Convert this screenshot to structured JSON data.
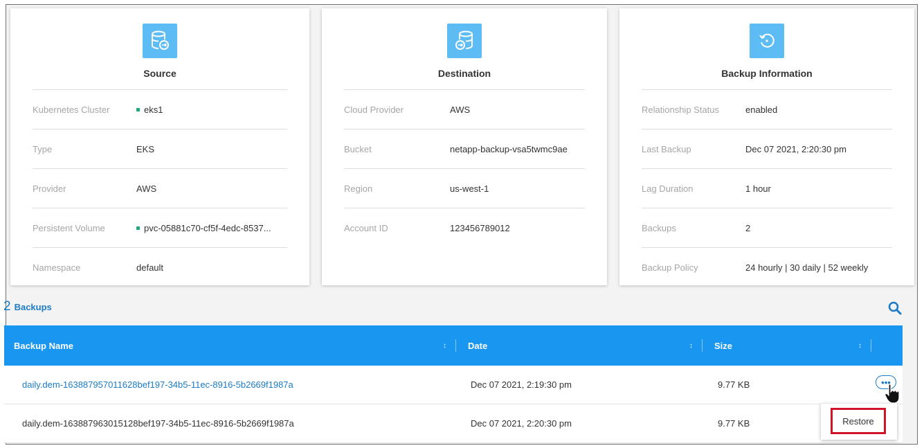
{
  "source": {
    "title": "Source",
    "icon": "database-arrow-icon",
    "rows": [
      {
        "label": "Kubernetes Cluster",
        "value": "eks1",
        "status": "active"
      },
      {
        "label": "Type",
        "value": "EKS"
      },
      {
        "label": "Provider",
        "value": "AWS"
      },
      {
        "label": "Persistent Volume",
        "value": "pvc-05881c70-cf5f-4edc-8537...",
        "status": "active"
      },
      {
        "label": "Namespace",
        "value": "default"
      }
    ]
  },
  "destination": {
    "title": "Destination",
    "icon": "database-backup-icon",
    "rows": [
      {
        "label": "Cloud Provider",
        "value": "AWS"
      },
      {
        "label": "Bucket",
        "value": "netapp-backup-vsa5twmc9ae"
      },
      {
        "label": "Region",
        "value": "us-west-1"
      },
      {
        "label": "Account ID",
        "value": "123456789012"
      }
    ]
  },
  "backup_info": {
    "title": "Backup Information",
    "icon": "restore-clock-icon",
    "rows": [
      {
        "label": "Relationship Status",
        "value": "enabled"
      },
      {
        "label": "Last Backup",
        "value": "Dec 07 2021, 2:20:30 pm"
      },
      {
        "label": "Lag Duration",
        "value": "1 hour"
      },
      {
        "label": "Backups",
        "value": "2"
      },
      {
        "label": "Backup Policy",
        "value": "24 hourly | 30 daily | 52 weekly"
      }
    ]
  },
  "backups": {
    "count": "2",
    "title": "Backups",
    "columns": [
      "Backup Name",
      "Date",
      "Size"
    ],
    "rows": [
      {
        "name": "daily.dem-163887957011628bef197-34b5-11ec-8916-5b2669f1987a",
        "date": "Dec 07 2021, 2:19:30 pm",
        "size": "9.77 KB"
      },
      {
        "name": "daily.dem-163887963015128bef197-34b5-11ec-8916-5b2669f1987a",
        "date": "Dec 07 2021, 2:20:30 pm",
        "size": "9.77 KB"
      }
    ]
  },
  "actions": {
    "more_label": "•••",
    "restore_label": "Restore"
  },
  "colors": {
    "accent": "#1996ef",
    "link": "#1c7bc4",
    "icon_bg": "#5cbcf3",
    "status_active": "#1fa97c",
    "highlight": "#d0152b"
  }
}
